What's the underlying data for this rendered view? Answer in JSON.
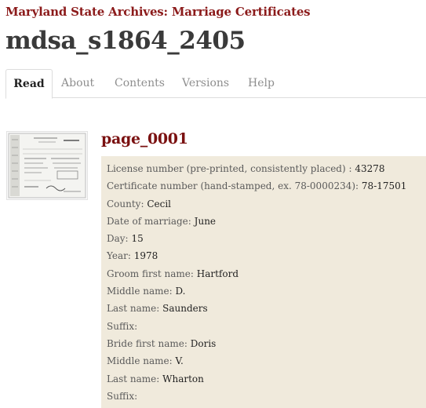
{
  "header": {
    "collection": "Maryland State Archives: Marriage Certificates",
    "title": "mdsa_s1864_2405"
  },
  "tabs": [
    {
      "label": "Read"
    },
    {
      "label": "About"
    },
    {
      "label": "Contents"
    },
    {
      "label": "Versions"
    },
    {
      "label": "Help"
    }
  ],
  "active_tab": "Read",
  "page": {
    "title": "page_0001",
    "fields": [
      {
        "label": "License number (pre-printed, consistently placed) :",
        "value": "43278"
      },
      {
        "label": "Certificate number (hand-stamped, ex. 78-0000234):",
        "value": "78-17501"
      },
      {
        "label": "County:",
        "value": "Cecil"
      },
      {
        "label": "Date of marriage:",
        "value": "June"
      },
      {
        "label": "Day:",
        "value": "15"
      },
      {
        "label": "Year:",
        "value": "1978"
      },
      {
        "label": "Groom first name:",
        "value": "Hartford"
      },
      {
        "label": "Middle name:",
        "value": "D."
      },
      {
        "label": "Last name:",
        "value": "Saunders"
      },
      {
        "label": "Suffix:",
        "value": ""
      },
      {
        "label": "Bride first name:",
        "value": "Doris"
      },
      {
        "label": "Middle name:",
        "value": "V."
      },
      {
        "label": "Last name:",
        "value": "Wharton"
      },
      {
        "label": "Suffix:",
        "value": ""
      }
    ]
  },
  "colors": {
    "accent": "#8b1a1a",
    "fields_background": "#f0eadc"
  }
}
